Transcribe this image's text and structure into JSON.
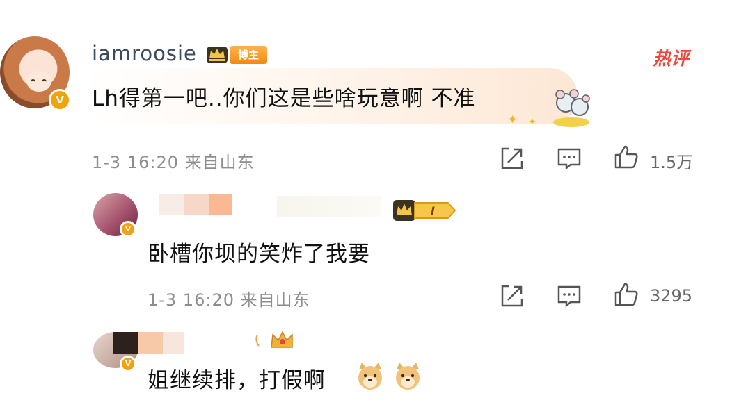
{
  "top_comment": {
    "username": "iamroosie",
    "badge_label": "博主",
    "hot_label": "热评",
    "text": "Lh得第一吧..你们这是些啥玩意啊 不准",
    "meta": "1-3 16:20 来自山东",
    "like_count": "1.5万"
  },
  "replies": [
    {
      "rank_label": "I",
      "text": "卧槽你坝的笑炸了我要",
      "meta": "1-3 16:20 来自山东",
      "like_count": "3295"
    },
    {
      "text": "姐继续排，打假啊"
    }
  ],
  "icons": {
    "share": "share-icon",
    "comment": "comment-icon",
    "like": "thumbs-up-icon"
  },
  "colors": {
    "accent_orange": "#f08a12",
    "hot_red": "#f0453a",
    "meta_gray": "#8d8d8d"
  }
}
